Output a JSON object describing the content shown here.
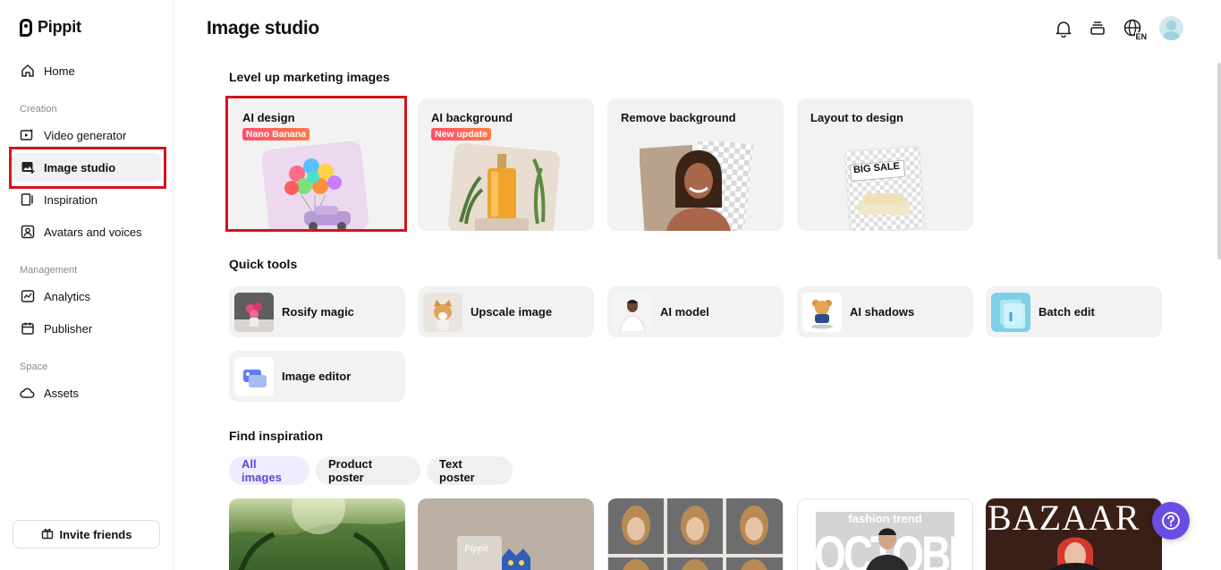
{
  "app": {
    "name": "Pippit"
  },
  "sidebar": {
    "items": [
      {
        "label": "Home",
        "icon": "home-icon"
      },
      {
        "label": "Video generator",
        "icon": "video-icon"
      },
      {
        "label": "Image studio",
        "icon": "image-icon",
        "active": true
      },
      {
        "label": "Inspiration",
        "icon": "inspiration-icon"
      },
      {
        "label": "Avatars and voices",
        "icon": "avatar-icon"
      },
      {
        "label": "Analytics",
        "icon": "analytics-icon"
      },
      {
        "label": "Publisher",
        "icon": "calendar-icon"
      },
      {
        "label": "Assets",
        "icon": "cloud-icon"
      }
    ],
    "sections": {
      "creation": "Creation",
      "management": "Management",
      "space": "Space"
    },
    "invite_label": "Invite friends"
  },
  "header": {
    "title": "Image studio",
    "language": "EN",
    "icons": [
      "bell-icon",
      "layers-icon",
      "globe-icon",
      "user-avatar"
    ]
  },
  "marketing": {
    "title": "Level up marketing images",
    "cards": [
      {
        "label": "AI design",
        "badge": "Nano Banana"
      },
      {
        "label": "AI background",
        "badge": "New update"
      },
      {
        "label": "Remove background"
      },
      {
        "label": "Layout to design",
        "sale_text": "BIG SALE"
      }
    ]
  },
  "quick_tools": {
    "title": "Quick tools",
    "items": [
      {
        "label": "Rosify magic"
      },
      {
        "label": "Upscale image"
      },
      {
        "label": "AI model"
      },
      {
        "label": "AI shadows"
      },
      {
        "label": "Batch edit"
      },
      {
        "label": "Image editor"
      }
    ]
  },
  "inspiration": {
    "title": "Find inspiration",
    "filters": [
      "All images",
      "Product poster",
      "Text poster"
    ],
    "active_filter": "All images",
    "thumb_texts": {
      "pippit_bottle": "Pippit",
      "fashion": "fashion trend",
      "october": "OCTOBER",
      "bazaar": "BAZAAR"
    }
  },
  "colors": {
    "accent": "#6b4de6",
    "highlight": "#d3141b",
    "badge": "#ff4f6a"
  }
}
